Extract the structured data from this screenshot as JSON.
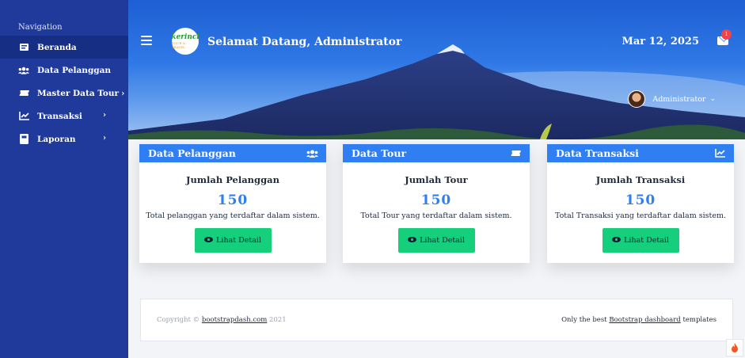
{
  "sidebar": {
    "section_title": "Navigation",
    "items": [
      {
        "label": "Beranda",
        "icon": "home-icon",
        "active": true
      },
      {
        "label": "Data Pelanggan",
        "icon": "users-icon"
      },
      {
        "label": "Master Data Tour",
        "icon": "ticket-icon",
        "chevron": "›"
      },
      {
        "label": "Transaksi",
        "icon": "chart-icon",
        "chevron": "›"
      },
      {
        "label": "Laporan",
        "icon": "book-icon",
        "chevron": "›"
      }
    ]
  },
  "header": {
    "logo_text": "kerinci",
    "logo_subtext": "TOUR & TRAVEL",
    "welcome": "Selamat Datang, Administrator",
    "date": "Mar 12, 2025",
    "notification_count": "1",
    "user_name": "Administrator"
  },
  "cards": [
    {
      "header": "Data Pelanggan",
      "icon": "users-icon",
      "title": "Jumlah Pelanggan",
      "value": "150",
      "description": "Total pelanggan yang terdaftar dalam sistem.",
      "button": "Lihat Detail"
    },
    {
      "header": "Data Tour",
      "icon": "ticket-icon",
      "title": "Jumlah Tour",
      "value": "150",
      "description": "Total Tour yang terdaftar dalam sistem.",
      "button": "Lihat Detail"
    },
    {
      "header": "Data Transaksi",
      "icon": "chart-icon",
      "title": "Jumlah Transaksi",
      "value": "150",
      "description": "Total Transaksi yang terdaftar dalam sistem.",
      "button": "Lihat Detail"
    }
  ],
  "footer": {
    "copyright_prefix": "Copyright ©",
    "copyright_link": "bootstrapdash.com",
    "copyright_year": "2021",
    "right_prefix": "Only the best",
    "right_link": "Bootstrap dashboard",
    "right_suffix": "templates"
  },
  "colors": {
    "sidebar": "#203a9c",
    "accent": "#2f7ff2",
    "button": "#15cf7d"
  }
}
